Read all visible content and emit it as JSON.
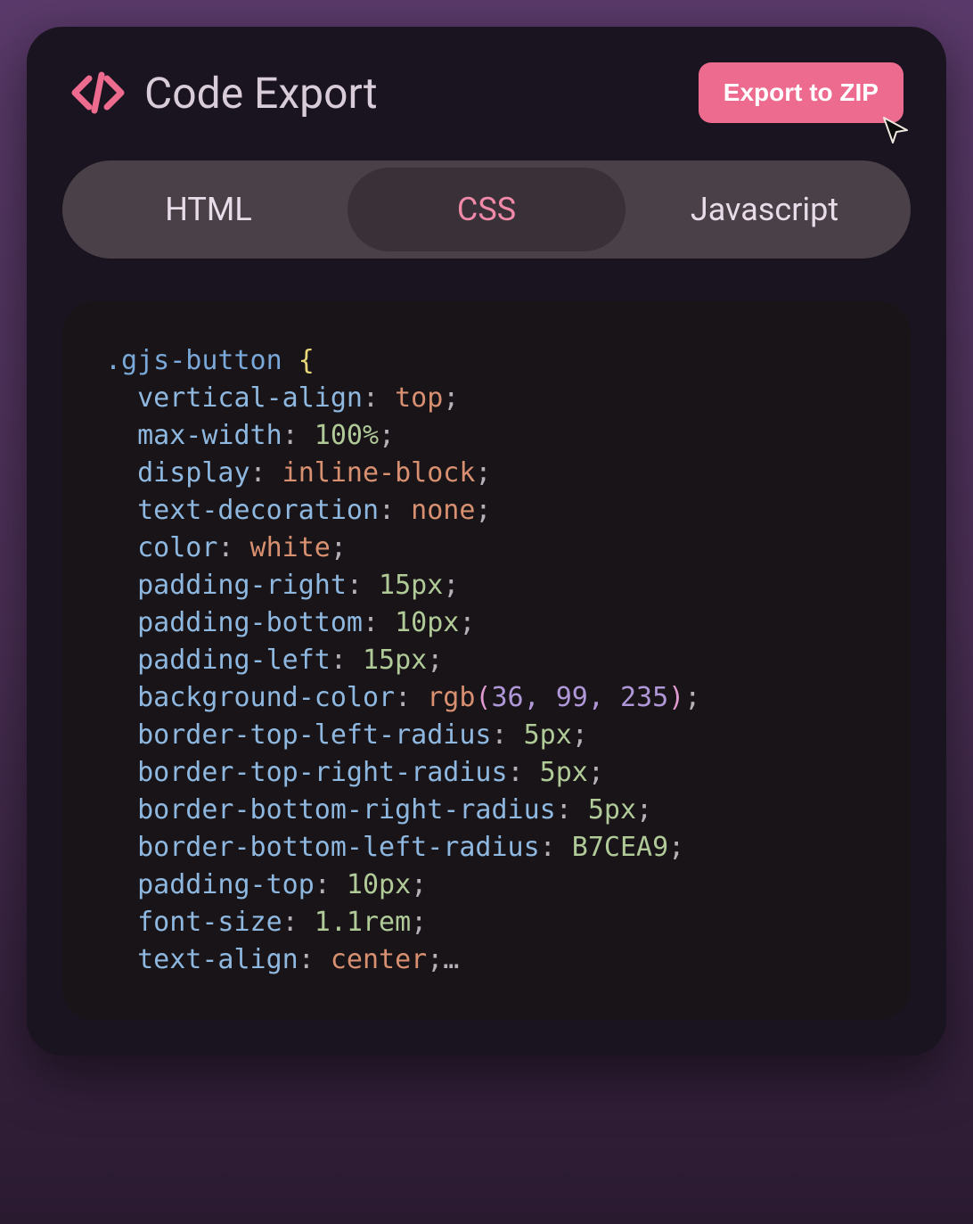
{
  "header": {
    "title": "Code Export",
    "export_button": "Export to ZIP"
  },
  "tabs": {
    "html": "HTML",
    "css": "CSS",
    "javascript": "Javascript",
    "active": "css"
  },
  "code": {
    "selector": ".gjs-button",
    "brace_open": "{",
    "lines": [
      {
        "prop": "vertical-align",
        "value": "top",
        "type": "keyword"
      },
      {
        "prop": "max-width",
        "value": "100%",
        "type": "number"
      },
      {
        "prop": "display",
        "value": "inline-block",
        "type": "keyword"
      },
      {
        "prop": "text-decoration",
        "value": "none",
        "type": "keyword"
      },
      {
        "prop": "color",
        "value": "white",
        "type": "keyword"
      },
      {
        "prop": "padding-right",
        "value": "15px",
        "type": "number"
      },
      {
        "prop": "padding-bottom",
        "value": "10px",
        "type": "number"
      },
      {
        "prop": "padding-left",
        "value": "15px",
        "type": "number"
      },
      {
        "prop": "background-color",
        "value_fn": "rgb",
        "value_args": "36, 99, 235",
        "type": "function"
      },
      {
        "prop": "border-top-left-radius",
        "value": "5px",
        "type": "number"
      },
      {
        "prop": "border-top-right-radius",
        "value": "5px",
        "type": "number"
      },
      {
        "prop": "border-bottom-right-radius",
        "value": "5px",
        "type": "number"
      },
      {
        "prop": "border-bottom-left-radius",
        "value": "B7CEA9",
        "type": "number"
      },
      {
        "prop": "padding-top",
        "value": "10px",
        "type": "number"
      },
      {
        "prop": "font-size",
        "value": "1.1rem",
        "type": "number"
      },
      {
        "prop": "text-align",
        "value": "center",
        "type": "keyword",
        "trailing": "…"
      }
    ]
  },
  "colors": {
    "accent": "#ec6b8f",
    "panel_bg": "#1a1420",
    "code_bg": "#181418",
    "tab_bg": "#4a4048",
    "tab_active_bg": "#3a3038"
  }
}
